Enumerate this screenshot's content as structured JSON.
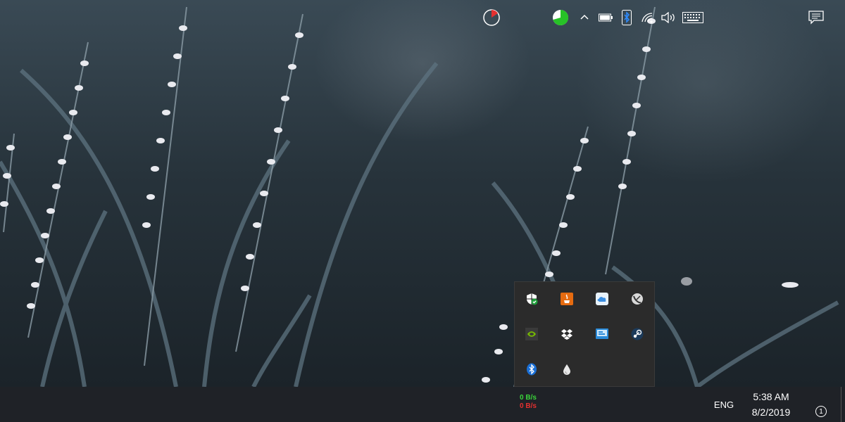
{
  "desktop": {
    "wallpaper": "white-wildflowers-in-dark-grass"
  },
  "tray_flyout": {
    "icons": [
      "windows-security-icon",
      "java-icon",
      "icloud-icon",
      "satellite-dish-icon",
      "nvidia-icon",
      "dropbox-icon",
      "display-settings-icon",
      "steam-icon",
      "bluetooth-icon",
      "water-drop-icon"
    ]
  },
  "taskbar": {
    "network_meter": {
      "upload": "0 B/s",
      "download": "0 B/s"
    },
    "language": "ENG",
    "clock": {
      "time": "5:38 AM",
      "date": "8/2/2019"
    },
    "notification_count": "1",
    "colors": {
      "upload": "#3ad43a",
      "download": "#e53030",
      "background": "#1f2227"
    }
  }
}
